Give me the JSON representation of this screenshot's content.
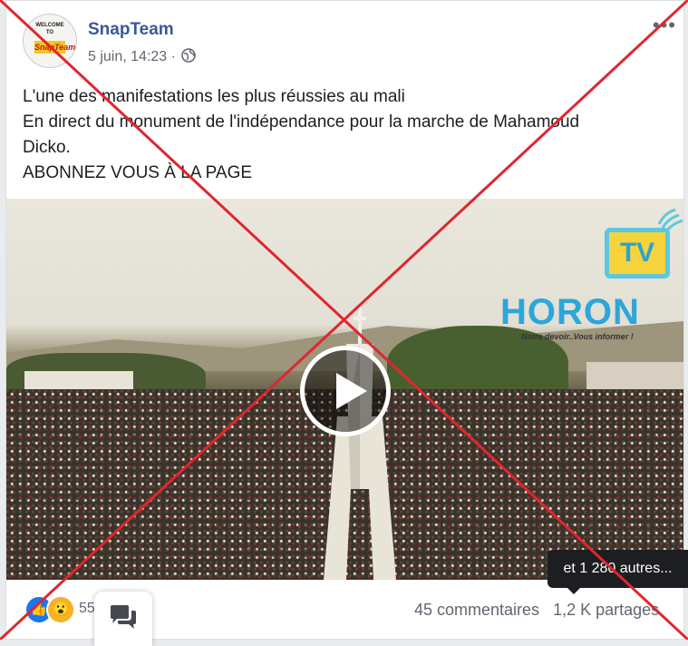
{
  "post": {
    "page_name": "SnapTeam",
    "timestamp": "5 juin, 14:23",
    "separator": "·",
    "privacy_icon": "globe-icon",
    "more_label": "•••",
    "avatar": {
      "line1": "WELCOME",
      "line2": "TO",
      "brand": "SnapTeam"
    },
    "text_lines": [
      "L'une des manifestations les plus réussies au mali",
      "En direct du monument de l'indépendance pour la marche de Mahamoud",
      "Dicko.",
      "ABONNEZ VOUS À LA PAGE"
    ]
  },
  "video": {
    "channel_tv": "TV",
    "channel_name": "HORON",
    "slogan": "Notre devoir..Vous informer !",
    "play_icon": "play-icon"
  },
  "tooltip": {
    "text": "et 1 280 autres..."
  },
  "footer": {
    "reaction_icons": [
      "like-icon",
      "wow-icon"
    ],
    "reaction_count": "55",
    "comments": "45 commentaires",
    "shares": "1,2 K partages",
    "chat_icon": "chat-icon"
  },
  "colors": {
    "page_name": "#385898",
    "meta": "#616770",
    "overlay_cross": "#e0262f",
    "like_blue": "#1877f2"
  }
}
